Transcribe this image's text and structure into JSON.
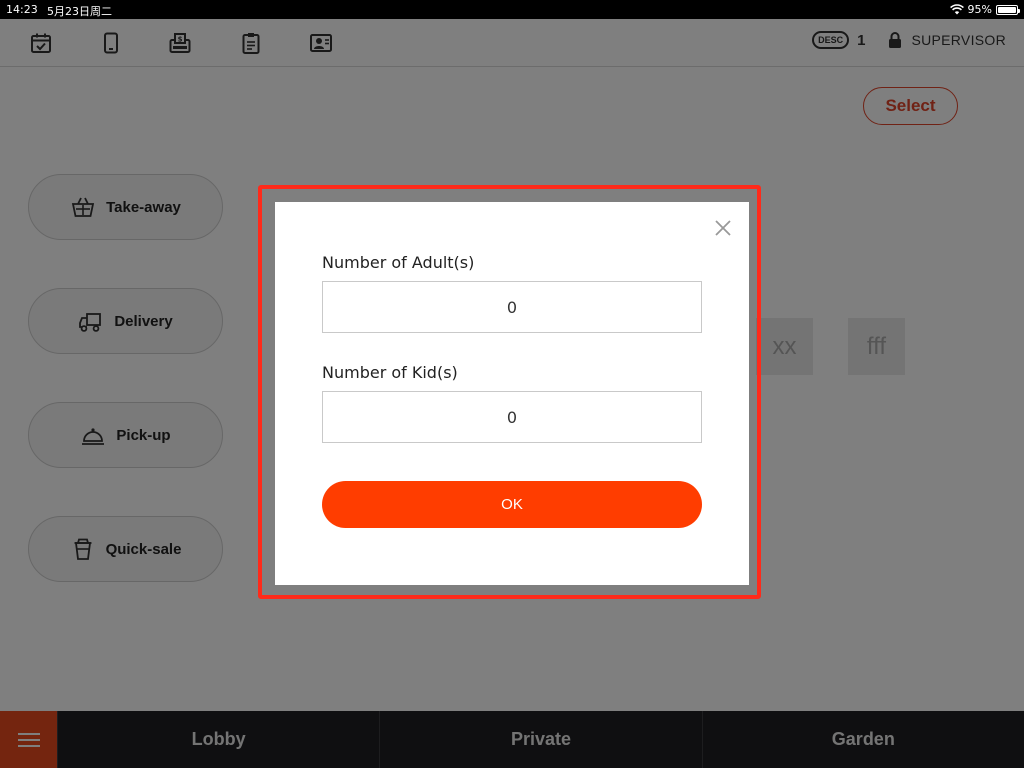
{
  "status_bar": {
    "time": "14:23",
    "date": "5月23日周二",
    "battery": "95%"
  },
  "toolbar": {
    "icons": [
      "calendar-check-icon",
      "tablet-icon",
      "cash-register-icon",
      "clipboard-icon",
      "user-card-icon"
    ],
    "desc_label": "DESC",
    "desc_count": "1",
    "user_role": "SUPERVISOR"
  },
  "main": {
    "select_label": "Select",
    "services": [
      {
        "label": "Take-away",
        "icon": "basket-icon"
      },
      {
        "label": "Delivery",
        "icon": "delivery-truck-icon"
      },
      {
        "label": "Pick-up",
        "icon": "service-bell-icon"
      },
      {
        "label": "Quick-sale",
        "icon": "cup-icon"
      }
    ],
    "tables": [
      "xx",
      "fff"
    ]
  },
  "modal": {
    "adult_label": "Number of Adult(s)",
    "adult_value": "0",
    "kid_label": "Number of Kid(s)",
    "kid_value": "0",
    "ok_label": "OK"
  },
  "tabs": [
    "Lobby",
    "Private",
    "Garden"
  ],
  "colors": {
    "accent": "#ff3d00",
    "highlight": "#ff2a1a",
    "select_border": "#e0452a",
    "tabbar": "#1e1f22"
  }
}
